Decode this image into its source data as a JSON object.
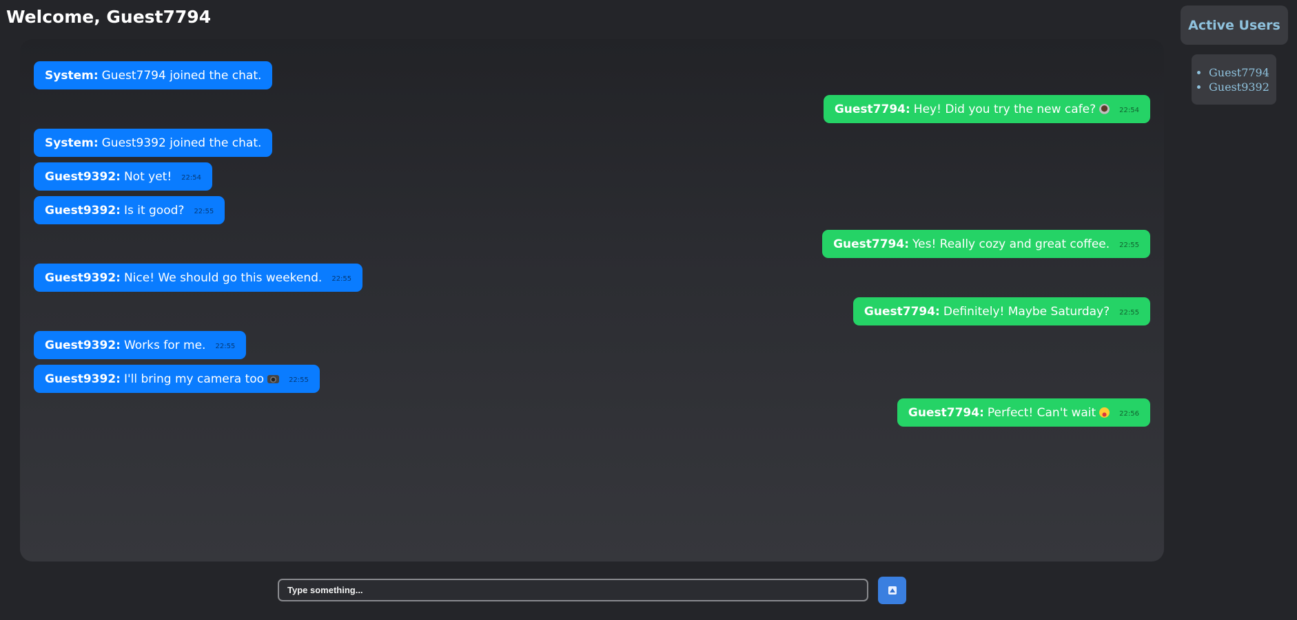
{
  "header": {
    "welcome": "Welcome, Guest7794"
  },
  "sidebar": {
    "title": "Active Users",
    "users": [
      "Guest7794",
      "Guest9392"
    ]
  },
  "messages": [
    {
      "side": "left",
      "sender": "System:",
      "text": "Guest7794 joined the chat.",
      "time": "",
      "emoji": ""
    },
    {
      "side": "right",
      "sender": "Guest7794:",
      "text": "Hey! Did you try the new cafe?",
      "time": "22:54",
      "emoji": "coffee-emoji"
    },
    {
      "side": "left",
      "sender": "System:",
      "text": "Guest9392 joined the chat.",
      "time": "",
      "emoji": ""
    },
    {
      "side": "left",
      "sender": "Guest9392:",
      "text": "Not yet!",
      "time": "22:54",
      "emoji": ""
    },
    {
      "side": "left",
      "sender": "Guest9392:",
      "text": "Is it good?",
      "time": "22:55",
      "emoji": ""
    },
    {
      "side": "right",
      "sender": "Guest7794:",
      "text": "Yes! Really cozy and great coffee.",
      "time": "22:55",
      "emoji": ""
    },
    {
      "side": "left",
      "sender": "Guest9392:",
      "text": "Nice! We should go this weekend.",
      "time": "22:55",
      "emoji": ""
    },
    {
      "side": "right",
      "sender": "Guest7794:",
      "text": "Definitely! Maybe Saturday?",
      "time": "22:55",
      "emoji": ""
    },
    {
      "side": "left",
      "sender": "Guest9392:",
      "text": "Works for me.",
      "time": "22:55",
      "emoji": ""
    },
    {
      "side": "left",
      "sender": "Guest9392:",
      "text": "I'll bring my camera too",
      "time": "22:55",
      "emoji": "camera-emoji"
    },
    {
      "side": "right",
      "sender": "Guest7794:",
      "text": "Perfect! Can't wait",
      "time": "22:56",
      "emoji": "smile-emoji"
    }
  ],
  "composer": {
    "placeholder": "Type something...",
    "send_icon": "send-icon"
  },
  "colors": {
    "background": "#242529",
    "own_bubble": "#25d366",
    "other_bubble": "#0a7cff",
    "accent_text": "#8fc2dd",
    "send_button": "#3a7fe0"
  }
}
